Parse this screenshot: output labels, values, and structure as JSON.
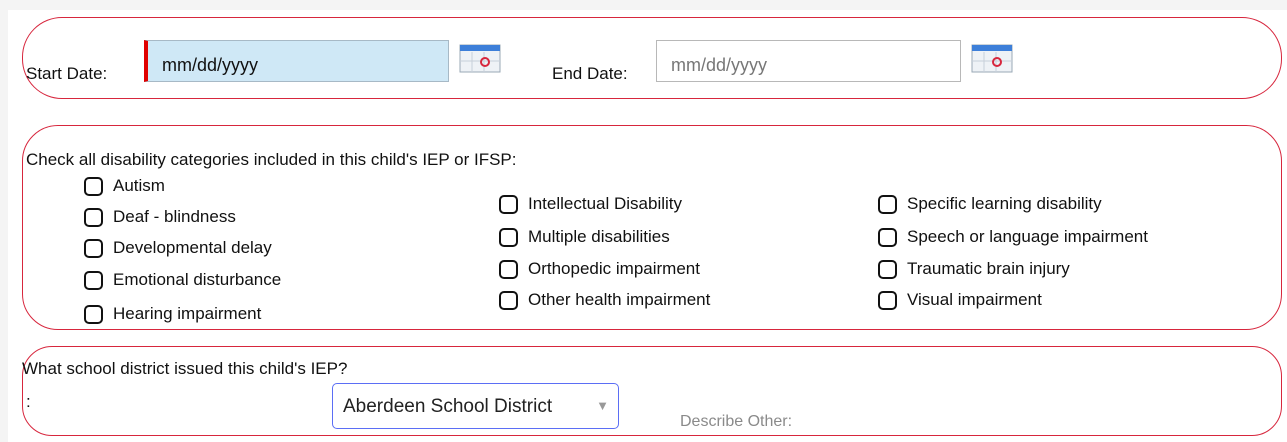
{
  "dates": {
    "start_label": "Start Date:",
    "start_placeholder": "mm/dd/yyyy",
    "end_label": "End Date:",
    "end_placeholder": "mm/dd/yyyy",
    "required_color": "#e00000",
    "icon": "calendar-icon"
  },
  "disabilities": {
    "prompt": "Check all disability categories included in this child's IEP or IFSP:",
    "column1": [
      "Autism",
      "Deaf - blindness",
      "Developmental delay",
      "Emotional disturbance",
      "Hearing impairment"
    ],
    "column2": [
      "Intellectual Disability",
      "Multiple disabilities",
      "Orthopedic impairment",
      "Other health impairment"
    ],
    "column3": [
      "Specific learning disability",
      "Speech or language impairment",
      "Traumatic brain injury",
      "Visual impairment"
    ]
  },
  "district": {
    "question": "What school district issued this child's IEP?",
    "colon": ":",
    "selected": "Aberdeen School District",
    "other_label": "Describe Other:"
  },
  "colors": {
    "section_border": "#d7263d",
    "input_highlight": "#cfe8f6",
    "select_focus": "#5b6ef5"
  }
}
